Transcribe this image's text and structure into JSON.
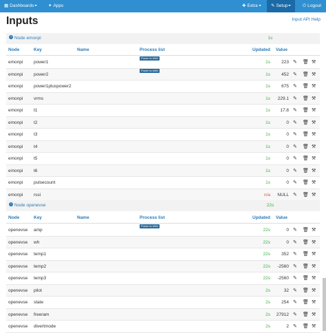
{
  "navbar": {
    "dashboards": "Dashboards",
    "apps": "Apps",
    "extra": "Extra",
    "setup": "Setup",
    "logout": "Logout"
  },
  "page": {
    "title": "Inputs",
    "api_help": "Input API Help"
  },
  "columns": {
    "node": "Node",
    "key": "Key",
    "name": "Name",
    "process": "Process list",
    "updated": "Updated",
    "value": "Value"
  },
  "nodes": [
    {
      "label": "Node emonpi",
      "updated": "1s",
      "rows": [
        {
          "node": "emonpi",
          "key": "power1",
          "name": "",
          "process": [
            "Allow positive",
            "Log to feed",
            "Power to kWh"
          ],
          "updated": "1s",
          "value": "223"
        },
        {
          "node": "emonpi",
          "key": "power2",
          "name": "",
          "process": [
            "Log to feed",
            "Power to kWh",
            "+ input",
            "Log to feed",
            "Power to kWh"
          ],
          "updated": "1s",
          "value": "452"
        },
        {
          "node": "emonpi",
          "key": "power1pluspower2",
          "name": "",
          "process": [],
          "updated": "1s",
          "value": "675"
        },
        {
          "node": "emonpi",
          "key": "vrms",
          "name": "",
          "process": [],
          "updated": "1s",
          "value": "229.1"
        },
        {
          "node": "emonpi",
          "key": "t1",
          "name": "",
          "process": [],
          "updated": "1s",
          "value": "17.8"
        },
        {
          "node": "emonpi",
          "key": "t2",
          "name": "",
          "process": [],
          "updated": "1s",
          "value": "0"
        },
        {
          "node": "emonpi",
          "key": "t3",
          "name": "",
          "process": [],
          "updated": "1s",
          "value": "0"
        },
        {
          "node": "emonpi",
          "key": "t4",
          "name": "",
          "process": [],
          "updated": "1s",
          "value": "0"
        },
        {
          "node": "emonpi",
          "key": "t5",
          "name": "",
          "process": [],
          "updated": "1s",
          "value": "0"
        },
        {
          "node": "emonpi",
          "key": "t6",
          "name": "",
          "process": [],
          "updated": "1s",
          "value": "0"
        },
        {
          "node": "emonpi",
          "key": "pulsecount",
          "name": "",
          "process": [],
          "updated": "1s",
          "value": "0"
        },
        {
          "node": "emonpi",
          "key": "rssi",
          "name": "",
          "process": [],
          "updated": "n/a",
          "value": "NULL"
        }
      ]
    },
    {
      "label": "Node openevse",
      "updated": "22s",
      "rows": [
        {
          "node": "openevse",
          "key": "amp",
          "name": "",
          "process": [
            "Log to feed",
            "Power to kWh"
          ],
          "updated": "22s",
          "value": "0"
        },
        {
          "node": "openevse",
          "key": "wh",
          "name": "",
          "process": [],
          "updated": "22s",
          "value": "0"
        },
        {
          "node": "openevse",
          "key": "temp1",
          "name": "",
          "process": [],
          "updated": "22s",
          "value": "352"
        },
        {
          "node": "openevse",
          "key": "temp2",
          "name": "",
          "process": [],
          "updated": "22s",
          "value": "-2560"
        },
        {
          "node": "openevse",
          "key": "temp3",
          "name": "",
          "process": [],
          "updated": "22s",
          "value": "-2560"
        },
        {
          "node": "openevse",
          "key": "pilot",
          "name": "",
          "process": [],
          "updated": "2s",
          "value": "32"
        },
        {
          "node": "openevse",
          "key": "state",
          "name": "",
          "process": [],
          "updated": "2s",
          "value": "254"
        },
        {
          "node": "openevse",
          "key": "freeram",
          "name": "",
          "process": [],
          "updated": "2s",
          "value": "27912"
        },
        {
          "node": "openevse",
          "key": "divertmode",
          "name": "",
          "process": [],
          "updated": "2s",
          "value": "2"
        }
      ]
    }
  ],
  "icons": {
    "edit": "pencil-icon",
    "delete": "trash-icon",
    "process": "wrench-icon"
  },
  "colors": {
    "navbar": "#2f8fd0",
    "link": "#2a7ab8",
    "updated_ok": "#3cb043",
    "updated_stale": "#d9534f",
    "badge": "#2d6a9a"
  }
}
